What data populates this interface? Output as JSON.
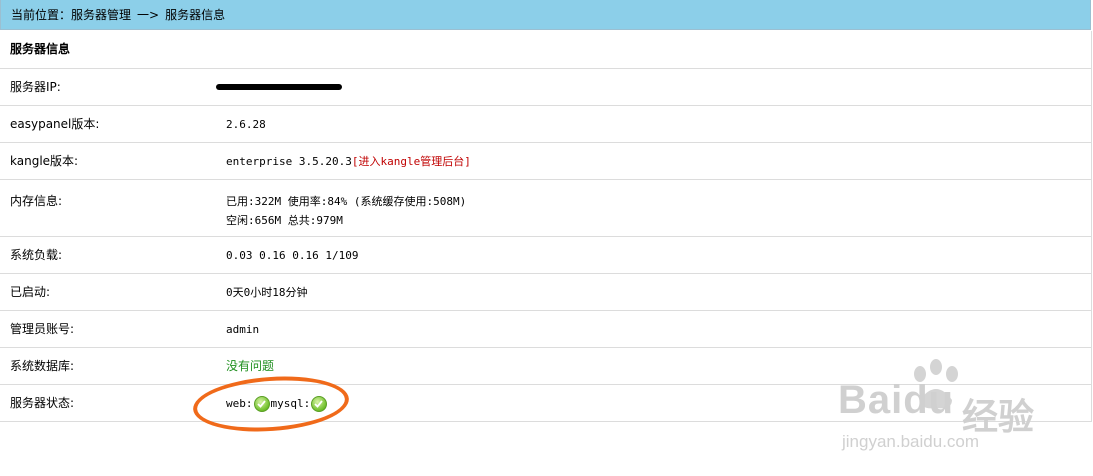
{
  "breadcrumb": {
    "prefix": "当前位置：",
    "section": "服务器管理",
    "separator": "一>",
    "current": "服务器信息"
  },
  "panel_title": "服务器信息",
  "rows": {
    "ip": {
      "label": "服务器IP:",
      "value_redacted": true
    },
    "easypanel": {
      "label": "easypanel版本:",
      "value": "2.6.28"
    },
    "kangle": {
      "label": "kangle版本:",
      "value": "enterprise 3.5.20.3",
      "link_text": "[进入kangle管理后台]"
    },
    "memory": {
      "label": "内存信息:",
      "line1": "已用:322M 使用率:84% (系统缓存使用:508M)",
      "line2": "空闲:656M 总共:979M"
    },
    "load": {
      "label": "系统负载:",
      "value": "0.03 0.16 0.16 1/109"
    },
    "uptime": {
      "label": "已启动:",
      "value": "0天0小时18分钟"
    },
    "admin": {
      "label": "管理员账号:",
      "value": "admin"
    },
    "database": {
      "label": "系统数据库:",
      "value": "没有问题"
    },
    "status": {
      "label": "服务器状态:",
      "web": "web:",
      "mysql": "mysql:",
      "icon": "check-icon"
    }
  },
  "watermark": {
    "brand": "Baidu",
    "product": "经验",
    "url": "jingyan.baidu.com"
  },
  "colors": {
    "topbar": "#8ccfe9",
    "link": "#c00000",
    "ok_text": "#1f8f1f",
    "annotation": "#f06a1a"
  }
}
